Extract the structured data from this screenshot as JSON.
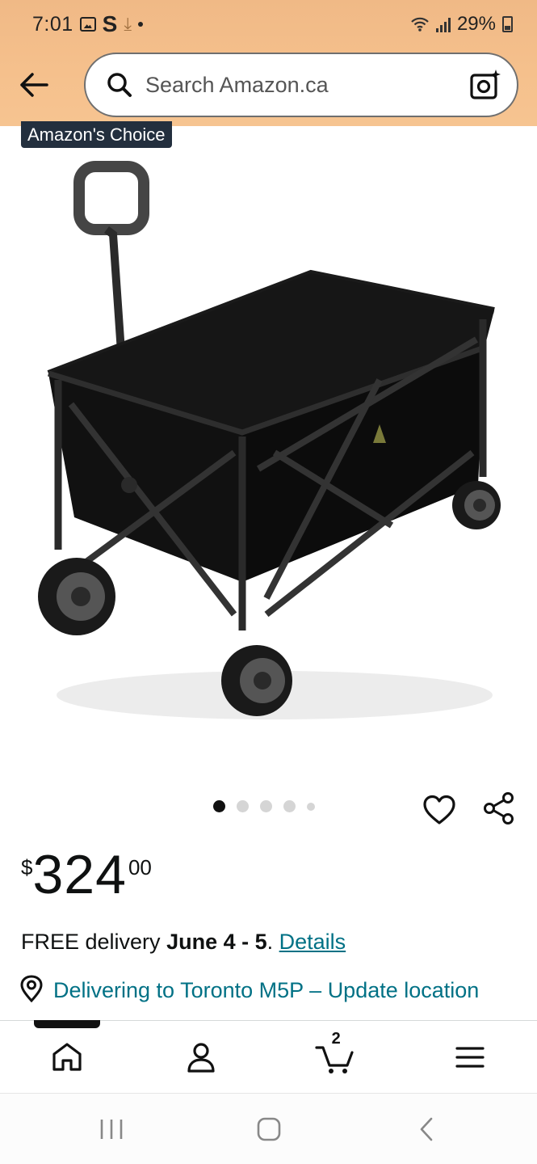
{
  "status_bar": {
    "time": "7:01",
    "battery": "29%"
  },
  "search": {
    "placeholder": "Search Amazon.ca"
  },
  "product": {
    "badge": "Amazon's Choice",
    "price": {
      "symbol": "$",
      "whole": "324",
      "fraction": "00"
    },
    "carousel": {
      "total": 5,
      "active_index": 0
    }
  },
  "delivery": {
    "prefix": "FREE delivery ",
    "dates": "June 4 - 5",
    "separator": ". ",
    "details_link": "Details"
  },
  "location": {
    "text": "Delivering to Toronto M5P – Update location"
  },
  "bottom_nav": {
    "cart_count": "2",
    "items": [
      "home-icon",
      "account-icon",
      "cart-icon",
      "menu-icon"
    ]
  },
  "colors": {
    "header_bg": "#f5c08c",
    "link": "#007185",
    "badge_bg": "#232f3e"
  }
}
